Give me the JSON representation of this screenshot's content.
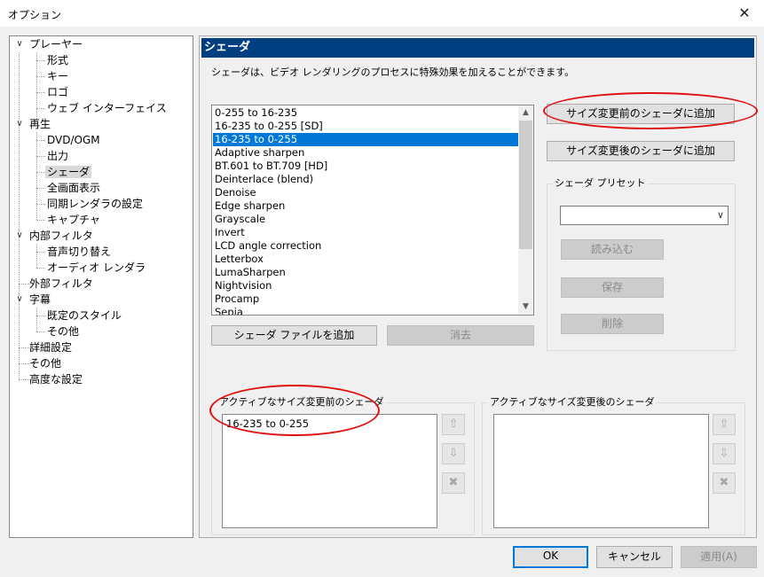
{
  "window": {
    "title": "オプション",
    "close_glyph": "✕"
  },
  "tree": {
    "items": [
      {
        "label": "プレーヤー",
        "expander": "∨"
      },
      {
        "label": "形式"
      },
      {
        "label": "キー"
      },
      {
        "label": "ロゴ"
      },
      {
        "label": "ウェブ インターフェイス"
      },
      {
        "label": "再生",
        "expander": "∨"
      },
      {
        "label": "DVD/OGM"
      },
      {
        "label": "出力"
      },
      {
        "label": "シェーダ",
        "selected": true
      },
      {
        "label": "全画面表示"
      },
      {
        "label": "同期レンダラの設定"
      },
      {
        "label": "キャプチャ"
      },
      {
        "label": "内部フィルタ",
        "expander": "∨"
      },
      {
        "label": "音声切り替え"
      },
      {
        "label": "オーディオ レンダラ"
      },
      {
        "label": "外部フィルタ"
      },
      {
        "label": "字幕",
        "expander": "∨"
      },
      {
        "label": "既定のスタイル"
      },
      {
        "label": "その他"
      },
      {
        "label": "詳細設定"
      },
      {
        "label": "その他"
      },
      {
        "label": "高度な設定"
      }
    ]
  },
  "panel": {
    "header": "シェーダ",
    "description": "シェーダは、ビデオ レンダリングのプロセスに特殊効果を加えることができます。",
    "shader_list": {
      "selected": "16-235 to 0-255",
      "items": [
        "0-255 to 16-235",
        "16-235 to 0-255 [SD]",
        "16-235 to 0-255",
        "Adaptive sharpen",
        "BT.601 to BT.709 [HD]",
        "Deinterlace (blend)",
        "Denoise",
        "Edge sharpen",
        "Grayscale",
        "Invert",
        "LCD angle correction",
        "Letterbox",
        "LumaSharpen",
        "Nightvision",
        "Procamp",
        "Sepia"
      ]
    },
    "buttons": {
      "add_pre_resize": "サイズ変更前のシェーダに追加",
      "add_post_resize": "サイズ変更後のシェーダに追加",
      "add_shader_file": "シェーダ ファイルを追加",
      "remove": "消去"
    },
    "preset": {
      "label": "シェーダ プリセット",
      "value": "",
      "load": "読み込む",
      "save": "保存",
      "delete": "削除"
    },
    "active_pre": {
      "label": "アクティブなサイズ変更前のシェーダ",
      "items": [
        "16-235 to 0-255"
      ]
    },
    "active_post": {
      "label": "アクティブなサイズ変更後のシェーダ",
      "items": []
    }
  },
  "footer": {
    "ok": "OK",
    "cancel": "キャンセル",
    "apply": "適用(A)"
  },
  "annotation_color": "#e01010",
  "selection_color": "#0078d7",
  "header_color": "#003f7f"
}
